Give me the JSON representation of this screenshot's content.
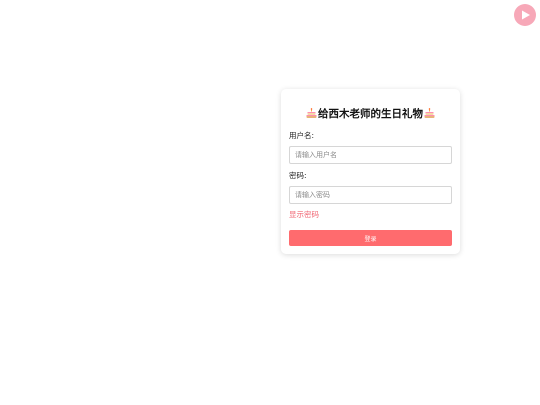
{
  "top_bar": {
    "play_icon": "play-icon"
  },
  "login": {
    "title": "给西木老师的生日礼物",
    "title_icon": "birthday-cake-icon",
    "username_label": "用户名:",
    "username_placeholder": "请输入用户名",
    "username_value": "",
    "password_label": "密码:",
    "password_placeholder": "请输入密码",
    "password_value": "",
    "show_password": "显示密码",
    "login_button": "登录"
  },
  "colors": {
    "accent": "#ff6b6e",
    "link": "#f06673",
    "play_button": "#f7a8b8"
  }
}
